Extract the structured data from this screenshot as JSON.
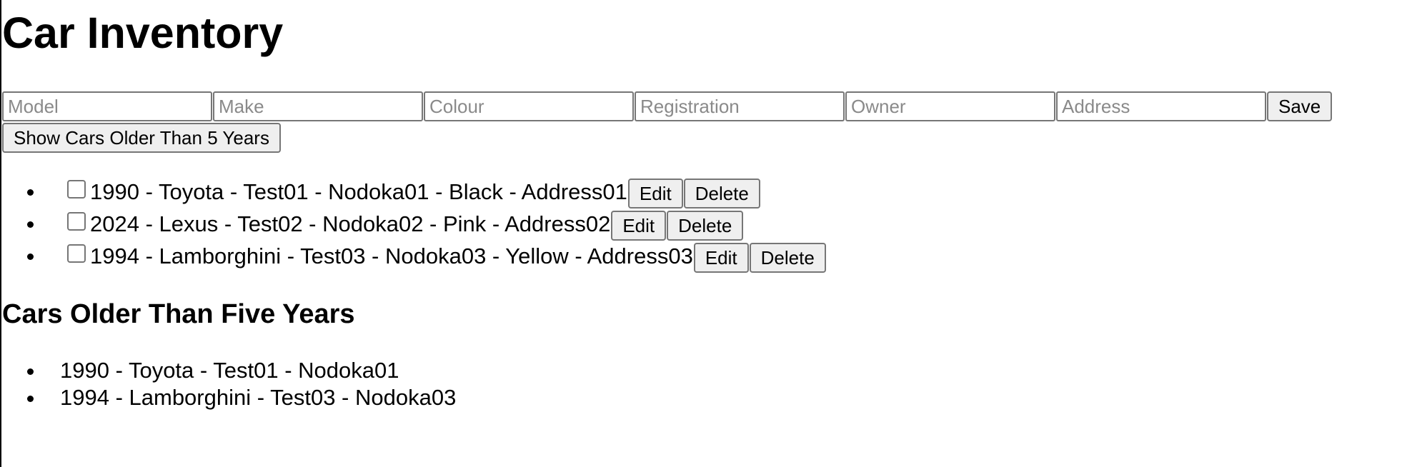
{
  "page": {
    "title": "Car Inventory"
  },
  "form": {
    "model_placeholder": "Model",
    "make_placeholder": "Make",
    "colour_placeholder": "Colour",
    "registration_placeholder": "Registration",
    "owner_placeholder": "Owner",
    "address_placeholder": "Address",
    "save_label": "Save",
    "older_button_label": "Show Cars Older Than 5 Years"
  },
  "cars": [
    {
      "text": "1990 - Toyota - Test01 - Nodoka01 - Black - Address01",
      "checked": false,
      "edit_label": "Edit",
      "delete_label": "Delete"
    },
    {
      "text": "2024 - Lexus - Test02 - Nodoka02 - Pink - Address02",
      "checked": false,
      "edit_label": "Edit",
      "delete_label": "Delete"
    },
    {
      "text": "1994 - Lamborghini - Test03 - Nodoka03 - Yellow - Address03",
      "checked": false,
      "edit_label": "Edit",
      "delete_label": "Delete"
    }
  ],
  "older_section": {
    "title": "Cars Older Than Five Years",
    "items": [
      "1990 - Toyota - Test01 - Nodoka01",
      "1994 - Lamborghini - Test03 - Nodoka03"
    ]
  }
}
